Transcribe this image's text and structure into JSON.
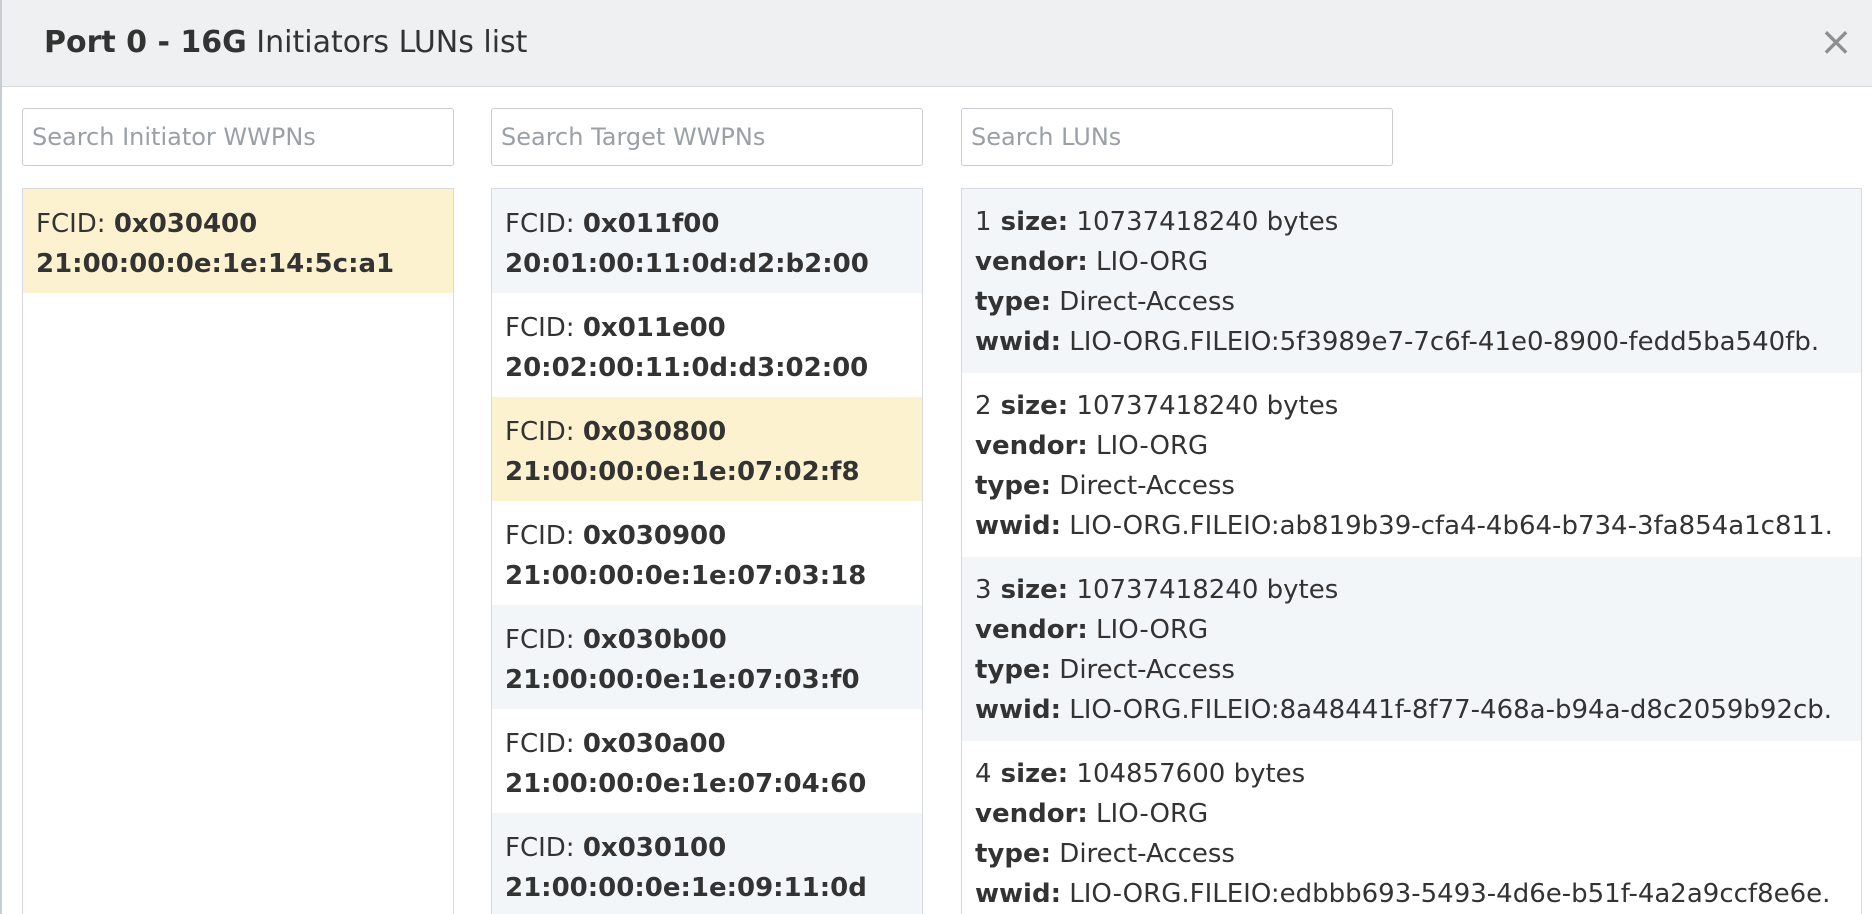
{
  "header": {
    "title_bold": "Port 0 - 16G",
    "title_rest": " Initiators LUNs list",
    "close_glyph": "×"
  },
  "search": {
    "initiator_placeholder": "Search Initiator WWPNs",
    "target_placeholder": "Search Target WWPNs",
    "lun_placeholder": "Search LUNs"
  },
  "initiators": [
    {
      "fcid_label": "FCID: ",
      "fcid": "0x030400",
      "wwpn": "21:00:00:0e:1e:14:5c:a1",
      "state": "selected"
    }
  ],
  "targets": [
    {
      "fcid_label": "FCID: ",
      "fcid": "0x011f00",
      "wwpn": "20:01:00:11:0d:d2:b2:00",
      "state": "alt"
    },
    {
      "fcid_label": "FCID: ",
      "fcid": "0x011e00",
      "wwpn": "20:02:00:11:0d:d3:02:00",
      "state": "normal"
    },
    {
      "fcid_label": "FCID: ",
      "fcid": "0x030800",
      "wwpn": "21:00:00:0e:1e:07:02:f8",
      "state": "selected"
    },
    {
      "fcid_label": "FCID: ",
      "fcid": "0x030900",
      "wwpn": "21:00:00:0e:1e:07:03:18",
      "state": "normal"
    },
    {
      "fcid_label": "FCID: ",
      "fcid": "0x030b00",
      "wwpn": "21:00:00:0e:1e:07:03:f0",
      "state": "alt"
    },
    {
      "fcid_label": "FCID: ",
      "fcid": "0x030a00",
      "wwpn": "21:00:00:0e:1e:07:04:60",
      "state": "normal"
    },
    {
      "fcid_label": "FCID: ",
      "fcid": "0x030100",
      "wwpn": "21:00:00:0e:1e:09:11:0d",
      "state": "alt"
    }
  ],
  "luns": [
    {
      "index": "1",
      "size_label": " size:",
      "size": " 10737418240 bytes",
      "vendor_label": "vendor:",
      "vendor": " LIO-ORG",
      "type_label": "type:",
      "type": " Direct-Access",
      "wwid_label": "wwid:",
      "wwid": " LIO-ORG.FILEIO:5f3989e7-7c6f-41e0-8900-fedd5ba540fb.",
      "state": "alt"
    },
    {
      "index": "2",
      "size_label": " size:",
      "size": " 10737418240 bytes",
      "vendor_label": "vendor:",
      "vendor": " LIO-ORG",
      "type_label": "type:",
      "type": " Direct-Access",
      "wwid_label": "wwid:",
      "wwid": " LIO-ORG.FILEIO:ab819b39-cfa4-4b64-b734-3fa854a1c811.",
      "state": "normal"
    },
    {
      "index": "3",
      "size_label": " size:",
      "size": " 10737418240 bytes",
      "vendor_label": "vendor:",
      "vendor": " LIO-ORG",
      "type_label": "type:",
      "type": " Direct-Access",
      "wwid_label": "wwid:",
      "wwid": " LIO-ORG.FILEIO:8a48441f-8f77-468a-b94a-d8c2059b92cb.",
      "state": "alt"
    },
    {
      "index": "4",
      "size_label": " size:",
      "size": " 104857600 bytes",
      "vendor_label": "vendor:",
      "vendor": " LIO-ORG",
      "type_label": "type:",
      "type": " Direct-Access",
      "wwid_label": "wwid:",
      "wwid": " LIO-ORG.FILEIO:edbbb693-5493-4d6e-b51f-4a2a9ccf8e6e.",
      "state": "normal"
    }
  ]
}
